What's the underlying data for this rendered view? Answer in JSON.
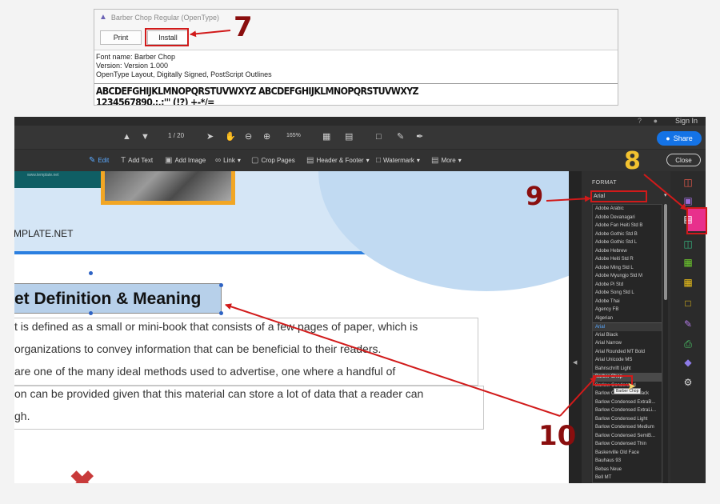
{
  "font_window": {
    "title": "Barber Chop Regular (OpenType)",
    "print_label": "Print",
    "install_label": "Install",
    "font_name": "Font name: Barber Chop",
    "version": "Version: Version 1.000",
    "details": "OpenType Layout, Digitally Signed, PostScript Outlines",
    "sample_letters": "ABCDEFGHIJKLMNOPQRSTUVWXYZ ABCDEFGHIJKLMNOPQRSTUVWXYZ",
    "sample_digits": "1234567890.:,;'\" (!?) +-*/="
  },
  "callouts": {
    "step7": "7",
    "step8": "8",
    "step9": "9",
    "step10": "10"
  },
  "acrobat": {
    "sign_in": "Sign In",
    "page_current": "1",
    "page_total": "/ 20",
    "zoom": "165%",
    "share_label": "Share",
    "close_label": "Close",
    "toolbar": {
      "edit": "Edit",
      "add_text": "Add Text",
      "add_image": "Add Image",
      "link": "Link",
      "crop_pages": "Crop Pages",
      "header_footer": "Header & Footer",
      "watermark": "Watermark",
      "more": "More"
    },
    "document": {
      "banner_small_text": "www.template.net",
      "brand": "MPLATE.NET",
      "heading": "et Definition & Meaning",
      "lines": [
        "t is defined as a small or mini-book that consists of a few pages of paper, which is",
        "organizations to convey information that can be beneficial to their readers.",
        "are one of the many ideal methods used to advertise, one where a handful of",
        "on can be provided given that this material can store a lot of data that a reader can",
        "gh."
      ]
    },
    "format_panel": {
      "title": "FORMAT",
      "font_value": "Arial",
      "font_list": [
        "Adobe Arabic",
        "Adobe Devanagari",
        "Adobe Fan Heiti Std B",
        "Adobe Gothic Std B",
        "Adobe Gothic Std L",
        "Adobe Hebrew",
        "Adobe Heiti Std R",
        "Adobe Ming Std L",
        "Adobe Myungjo Std M",
        "Adobe Pi Std",
        "Adobe Song Std L",
        "Adobe Thai",
        "Agency FB",
        "Algerian",
        "Arial",
        "Arial Black",
        "Arial Narrow",
        "Arial Rounded MT Bold",
        "Arial Unicode MS",
        "Bahnschrift Light",
        "Barber Chop",
        "Barlow Condensed",
        "Barlow Condensed Black",
        "Barlow Condensed ExtraB...",
        "Barlow Condensed ExtraLi...",
        "Barlow Condensed Light",
        "Barlow Condensed Medium",
        "Barlow Condensed SemiB...",
        "Barlow Condensed Thin",
        "Baskerville Old Face",
        "Bauhaus 93",
        "Bebas Neue",
        "Bell MT"
      ],
      "selected_font": "Arial",
      "hovered_font": "Barber Chop",
      "tooltip": "Barber Chop"
    }
  }
}
